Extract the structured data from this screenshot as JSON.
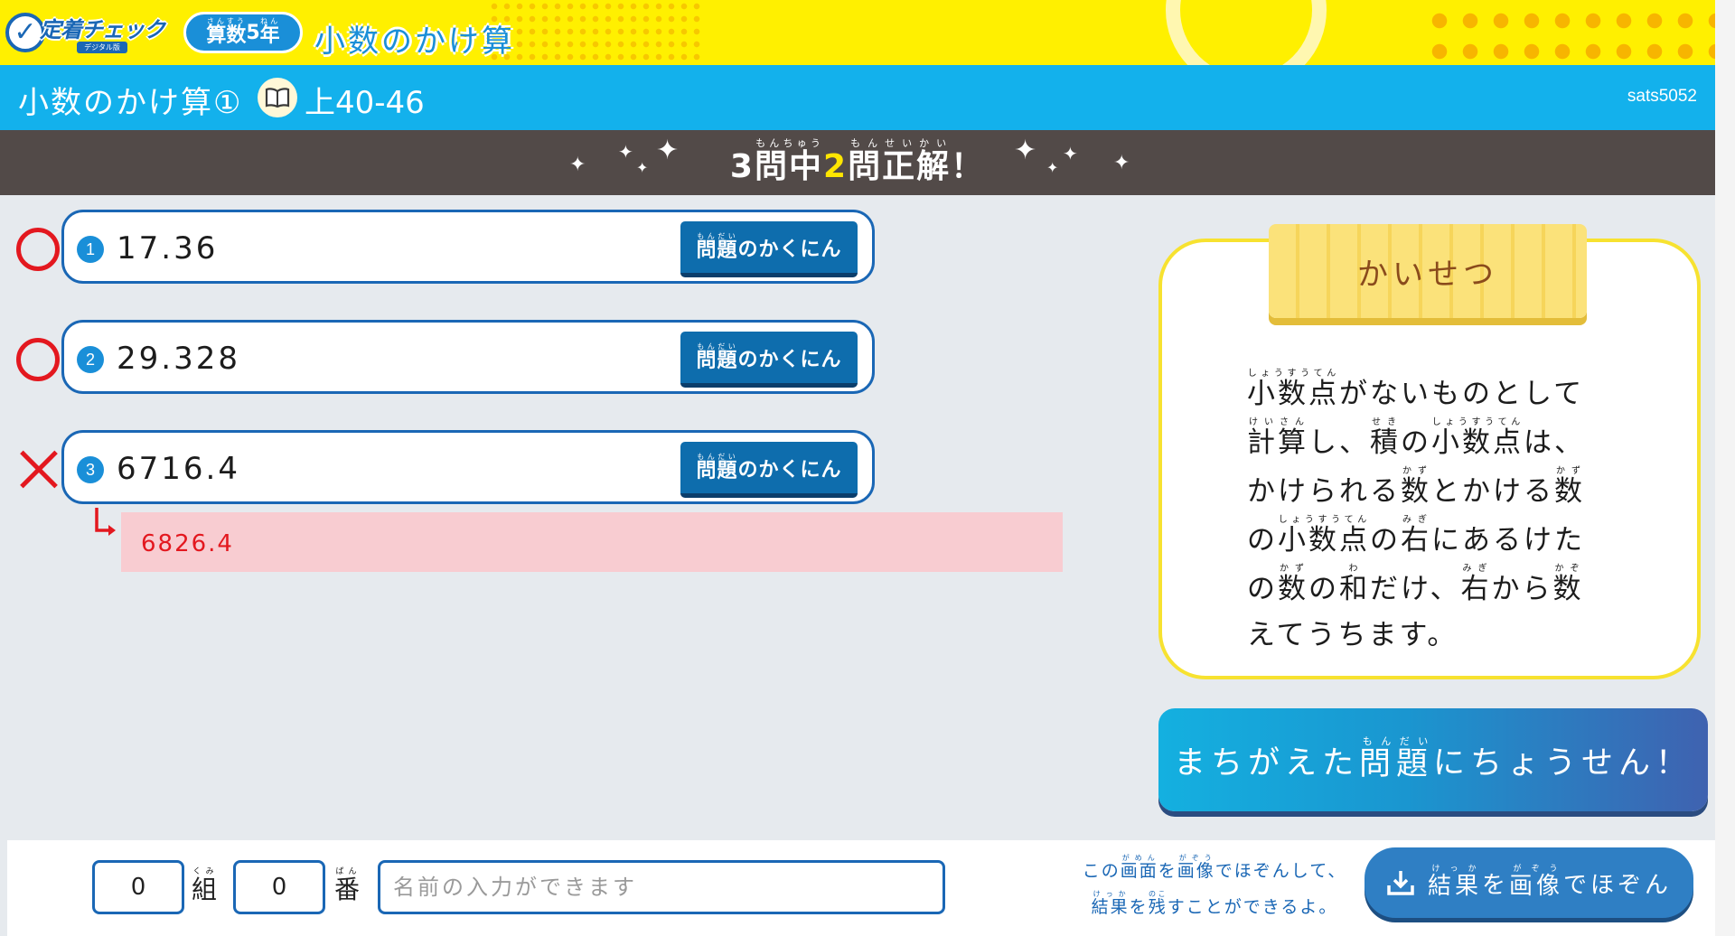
{
  "header": {
    "logo_title": "定着チェック",
    "logo_sub": "デジタル版",
    "grade_kanji_1": "算数",
    "grade_ruby_1": "さんすう",
    "grade_num": "5",
    "grade_kanji_2": "年",
    "grade_ruby_2": "ねん",
    "topic": "小数のかけ算"
  },
  "unit": {
    "title": "小数のかけ算①",
    "pages": "上40-46",
    "code": "sats5052"
  },
  "score": {
    "total": "3",
    "mon_kanji": "問",
    "naka_kanji": "中",
    "ruby_monchuu": "もんちゅう",
    "correct": "2",
    "seikai_kanji": "問正解",
    "ruby_monseikai": "もんせいかい",
    "suffix": "！"
  },
  "answers": [
    {
      "num": "1",
      "value": "17.36",
      "result": "correct"
    },
    {
      "num": "2",
      "value": "29.328",
      "result": "correct"
    },
    {
      "num": "3",
      "value": "6716.4",
      "result": "wrong",
      "correct_value": "6826.4"
    }
  ],
  "check_button": {
    "kanji": "問題",
    "ruby": "もんだい",
    "rest": "のかくにん"
  },
  "explanation": {
    "title": "かいせつ",
    "line1_kanji": "小数点",
    "line1_ruby": "しょうすうてん",
    "line1_rest": "がないものとして",
    "line2_kanji1": "計算",
    "line2_ruby1": "けいさん",
    "line2_mid": "し、",
    "line2_kanji2": "積",
    "line2_ruby2": "せき",
    "line2_mid2": "の",
    "line2_kanji3": "小数点",
    "line2_ruby3": "しょうすうてん",
    "line2_rest": "は、",
    "line3_pre": "かけられる",
    "line3_kanji1": "数",
    "line3_ruby1": "かず",
    "line3_mid": "とかける",
    "line3_kanji2": "数",
    "line3_ruby2": "かず",
    "line4_pre": "の",
    "line4_kanji1": "小数点",
    "line4_ruby1": "しょうすうてん",
    "line4_mid": "の",
    "line4_kanji2": "右",
    "line4_ruby2": "みぎ",
    "line4_rest": "にあるけた",
    "line5_pre": "の",
    "line5_kanji1": "数",
    "line5_ruby1": "かず",
    "line5_mid": "の",
    "line5_kanji2": "和",
    "line5_ruby2": "わ",
    "line5_mid2": "だけ、",
    "line5_kanji3": "右",
    "line5_ruby3": "みぎ",
    "line5_mid3": "から",
    "line5_kanji4": "数",
    "line5_ruby4": "かぞ",
    "line6": "えてうちます。"
  },
  "challenge": {
    "pre": "まちがえた",
    "kanji": "問題",
    "ruby": "もんだい",
    "post": "にちょうせん！"
  },
  "footer": {
    "class_value": "0",
    "kumi_kanji": "組",
    "kumi_ruby": "くみ",
    "number_value": "0",
    "ban_kanji": "番",
    "ban_ruby": "ばん",
    "name_placeholder": "名前の入力ができます",
    "note_pre": "この",
    "note_kanji1": "画面",
    "note_ruby1": "がめん",
    "note_mid": "を",
    "note_kanji2": "画像",
    "note_ruby2": "がぞう",
    "note_post": "でほぞんして、",
    "note2_kanji1": "結果",
    "note2_ruby1": "けっか",
    "note2_mid": "を",
    "note2_kanji2": "残",
    "note2_ruby2": "のこ",
    "note2_post": "すことができるよ。",
    "save_kanji1": "結果",
    "save_ruby1": "けっか",
    "save_mid": "を",
    "save_kanji2": "画像",
    "save_ruby2": "がぞう",
    "save_post": "でほぞん"
  },
  "colors": {
    "accent_blue": "#13b1ec",
    "mark_red": "#e3181f",
    "header_yellow": "#fff000"
  }
}
